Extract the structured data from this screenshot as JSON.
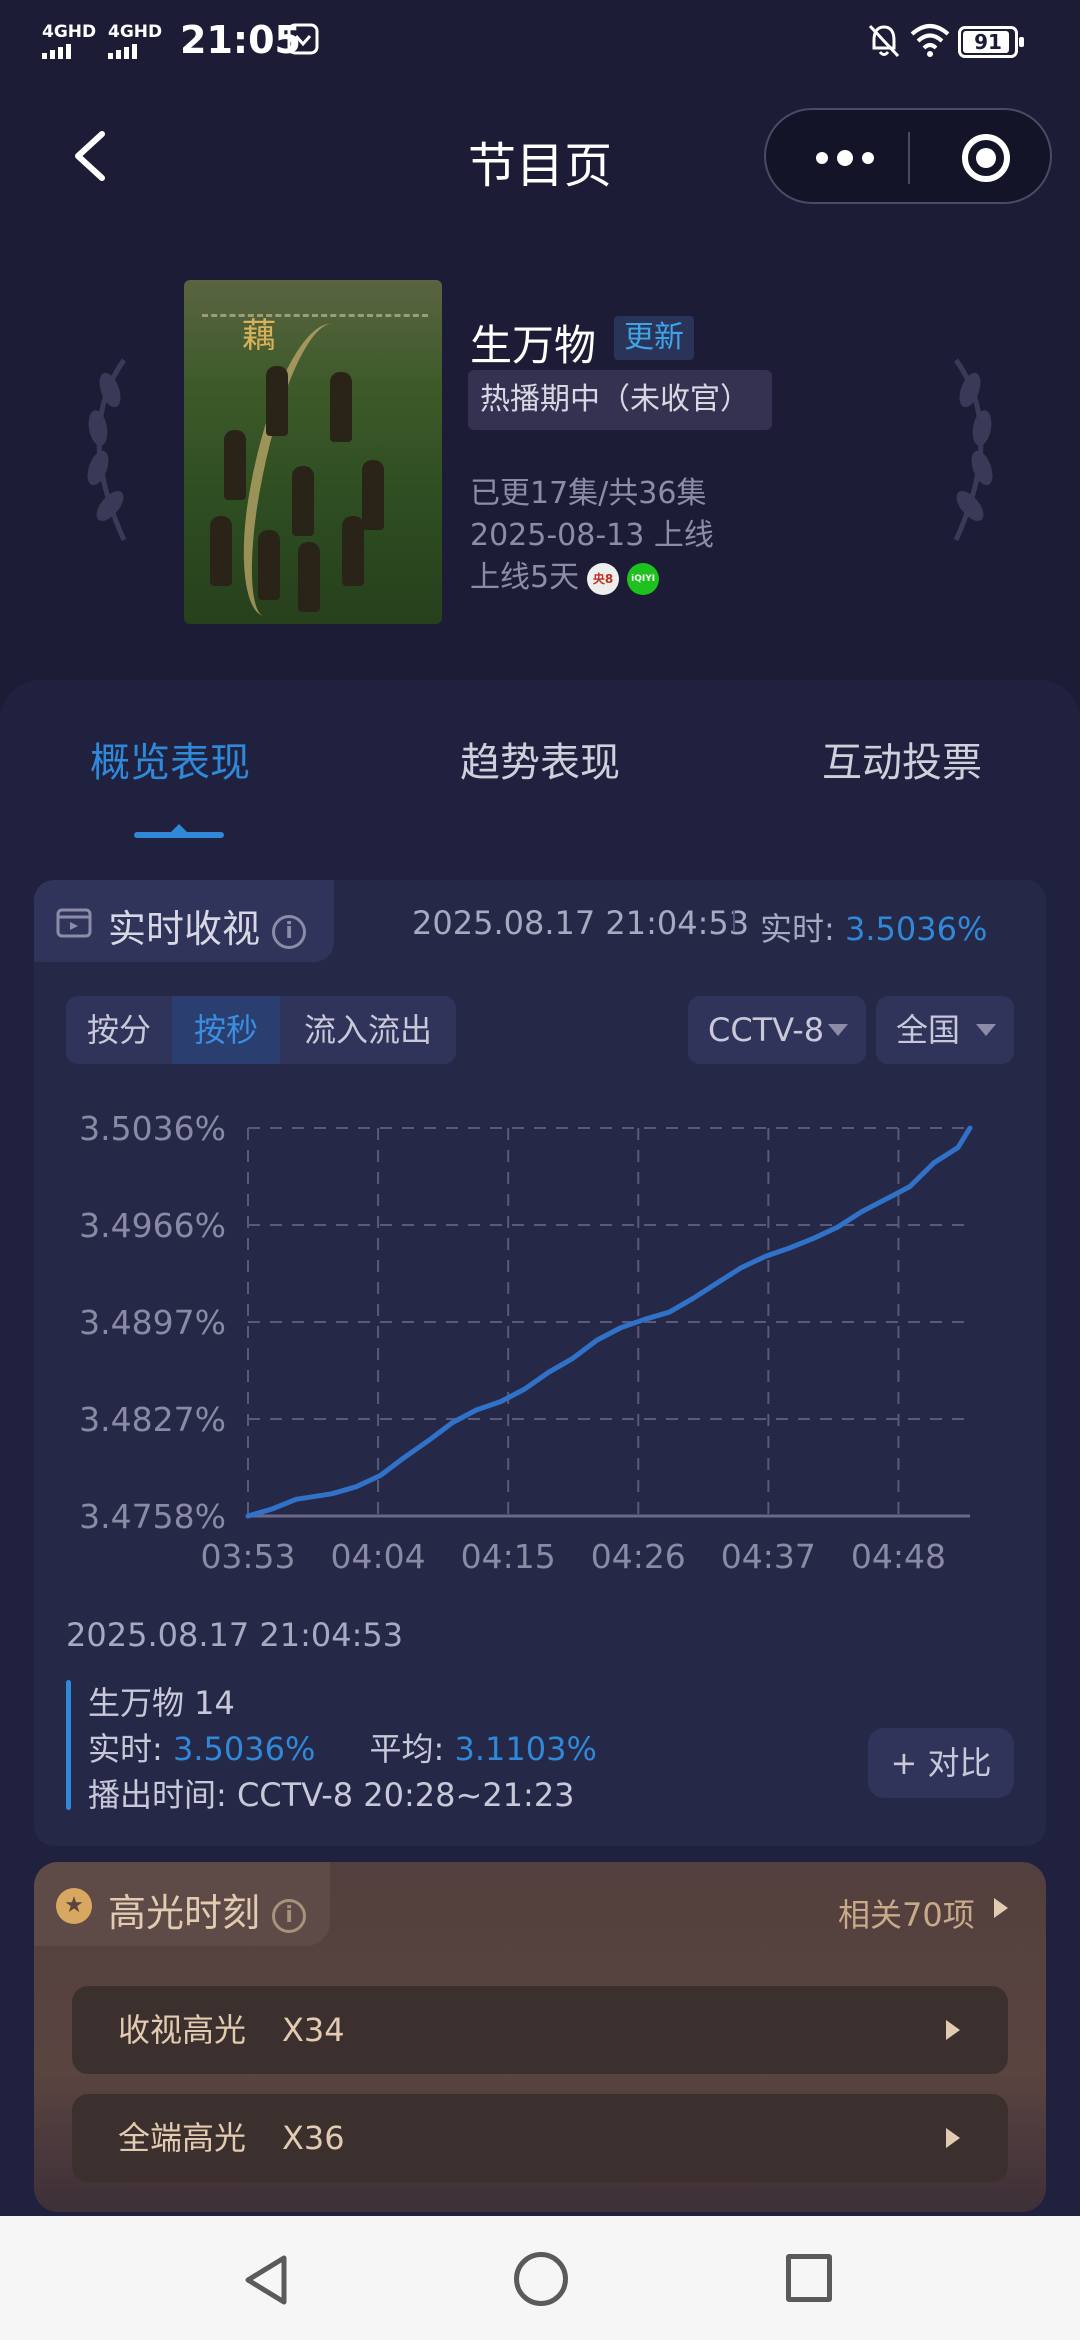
{
  "status_bar": {
    "signal_1": "4GHD",
    "signal_2": "4GHD",
    "time": "21:05",
    "battery": "91",
    "battery_level": 0.91
  },
  "nav": {
    "title": "节目页"
  },
  "show": {
    "title": "生万物",
    "update_badge": "更新",
    "status": "热播期中（未收官）",
    "episodes": "已更17集/共36集",
    "release_date": "2025-08-13 上线",
    "days_online": "上线5天",
    "platforms": [
      "央8",
      "iQIYI"
    ]
  },
  "tabs": [
    {
      "label": "概览表现",
      "active": true
    },
    {
      "label": "趋势表现",
      "active": false
    },
    {
      "label": "互动投票",
      "active": false
    }
  ],
  "realtime": {
    "title": "实时收视",
    "info_icon": "i",
    "timestamp": "2025.08.17 21:04:53",
    "label": "实时:",
    "value": "3.5036%",
    "segments": [
      "按分",
      "按秒",
      "流入流出"
    ],
    "active_segment": 1,
    "channel_dropdown": "CCTV-8",
    "region_dropdown": "全国"
  },
  "chart_data": {
    "type": "line",
    "title": "",
    "xlabel": "",
    "ylabel": "",
    "x_ticks": [
      "03:53",
      "04:04",
      "04:15",
      "04:26",
      "04:37",
      "04:48"
    ],
    "y_ticks": [
      "3.5036%",
      "3.4966%",
      "3.4897%",
      "3.4827%",
      "3.4758%"
    ],
    "ylim": [
      3.4758,
      3.5036
    ],
    "grid": true,
    "series": [
      {
        "name": "",
        "color": "#2f72c8",
        "x_minutes": [
          0,
          2,
          4,
          7,
          9,
          11,
          13,
          15,
          17,
          19,
          21,
          23,
          25,
          27,
          29,
          31,
          33,
          35,
          37,
          39,
          41,
          43,
          45,
          47,
          49,
          51,
          53,
          55,
          57,
          59,
          60
        ],
        "values": [
          3.4758,
          3.4763,
          3.477,
          3.4774,
          3.4779,
          3.4787,
          3.48,
          3.4812,
          3.4825,
          3.4834,
          3.484,
          3.4849,
          3.4861,
          3.4871,
          3.4884,
          3.4893,
          3.4899,
          3.4904,
          3.4914,
          3.4925,
          3.4936,
          3.4944,
          3.495,
          3.4957,
          3.4965,
          3.4976,
          3.4985,
          3.4994,
          3.5011,
          3.5022,
          3.5036
        ]
      }
    ]
  },
  "detail": {
    "timestamp": "2025.08.17 21:04:53",
    "episode": "生万物 14",
    "realtime_label": "实时:",
    "realtime_value": "3.5036%",
    "avg_label": "平均:",
    "avg_value": "3.1103%",
    "airtime": "播出时间:  CCTV-8 20:28~21:23",
    "compare_button": "+ 对比"
  },
  "highlights": {
    "title": "高光时刻",
    "related": "相关70项",
    "rows": [
      {
        "label": "收视高光",
        "value": "X34"
      },
      {
        "label": "全端高光",
        "value": "X36"
      }
    ]
  },
  "colors": {
    "background": "#1c1c36",
    "accent": "#2f88d8",
    "highlight_bg": "#52403e"
  }
}
